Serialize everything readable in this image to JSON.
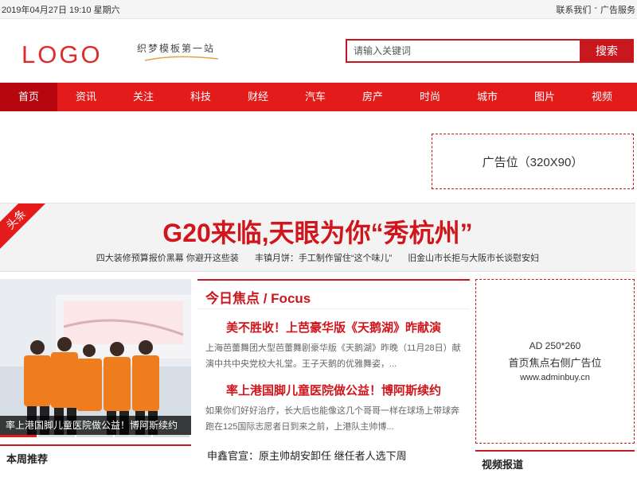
{
  "topbar": {
    "datetime": "2019年04月27日 19:10 星期六",
    "contact": "联系我们",
    "sep": "-",
    "ad_service": "广告服务"
  },
  "header": {
    "logo": "LOGO",
    "slogan": "织梦模板第一站",
    "search_placeholder": "请输入关键词",
    "search_button": "搜索"
  },
  "nav": [
    "首页",
    "资讯",
    "关注",
    "科技",
    "财经",
    "汽车",
    "房产",
    "时尚",
    "城市",
    "图片",
    "视频"
  ],
  "ad_top": "广告位（320X90）",
  "headline": {
    "ribbon": "头条",
    "title": "G20来临,天眼为你“秀杭州”",
    "links": [
      "四大装修预算报价黑幕 你避开这些装",
      "丰镇月饼：手工制作留住“这个味儿”",
      "旧金山市长拒与大阪市长谈慰安妇"
    ]
  },
  "photo": {
    "caption": "率上港国脚儿童医院做公益！博阿斯续约"
  },
  "weekly": {
    "title": "本周推荐"
  },
  "focus": {
    "title": "今日焦点 / Focus",
    "items": [
      {
        "title": "美不胜收！上芭豪华版《天鹅湖》昨献演",
        "desc": "上海芭蕾舞团大型芭蕾舞剧豪华版《天鹅湖》昨晚（11月28日）献演中共中央党校大礼堂。王子天鹅的优雅舞姿，..."
      },
      {
        "title": "率上港国脚儿童医院做公益！博阿斯续约",
        "desc": "如果你们好好治疗，长大后也能像这几个哥哥一样在球场上带球奔跑在125国际志愿者日到来之前，上港队主帅博..."
      }
    ],
    "plain": "申鑫官宣：原主帅胡安卸任 继任者人选下周"
  },
  "ad_side": {
    "line1": "AD 250*260",
    "line2": "首页焦点右侧广告位",
    "line3": "www.adminbuy.cn"
  },
  "video": {
    "title": "视频报道"
  },
  "colors": {
    "accent": "#e31b1b",
    "dark_accent": "#b5070d"
  }
}
